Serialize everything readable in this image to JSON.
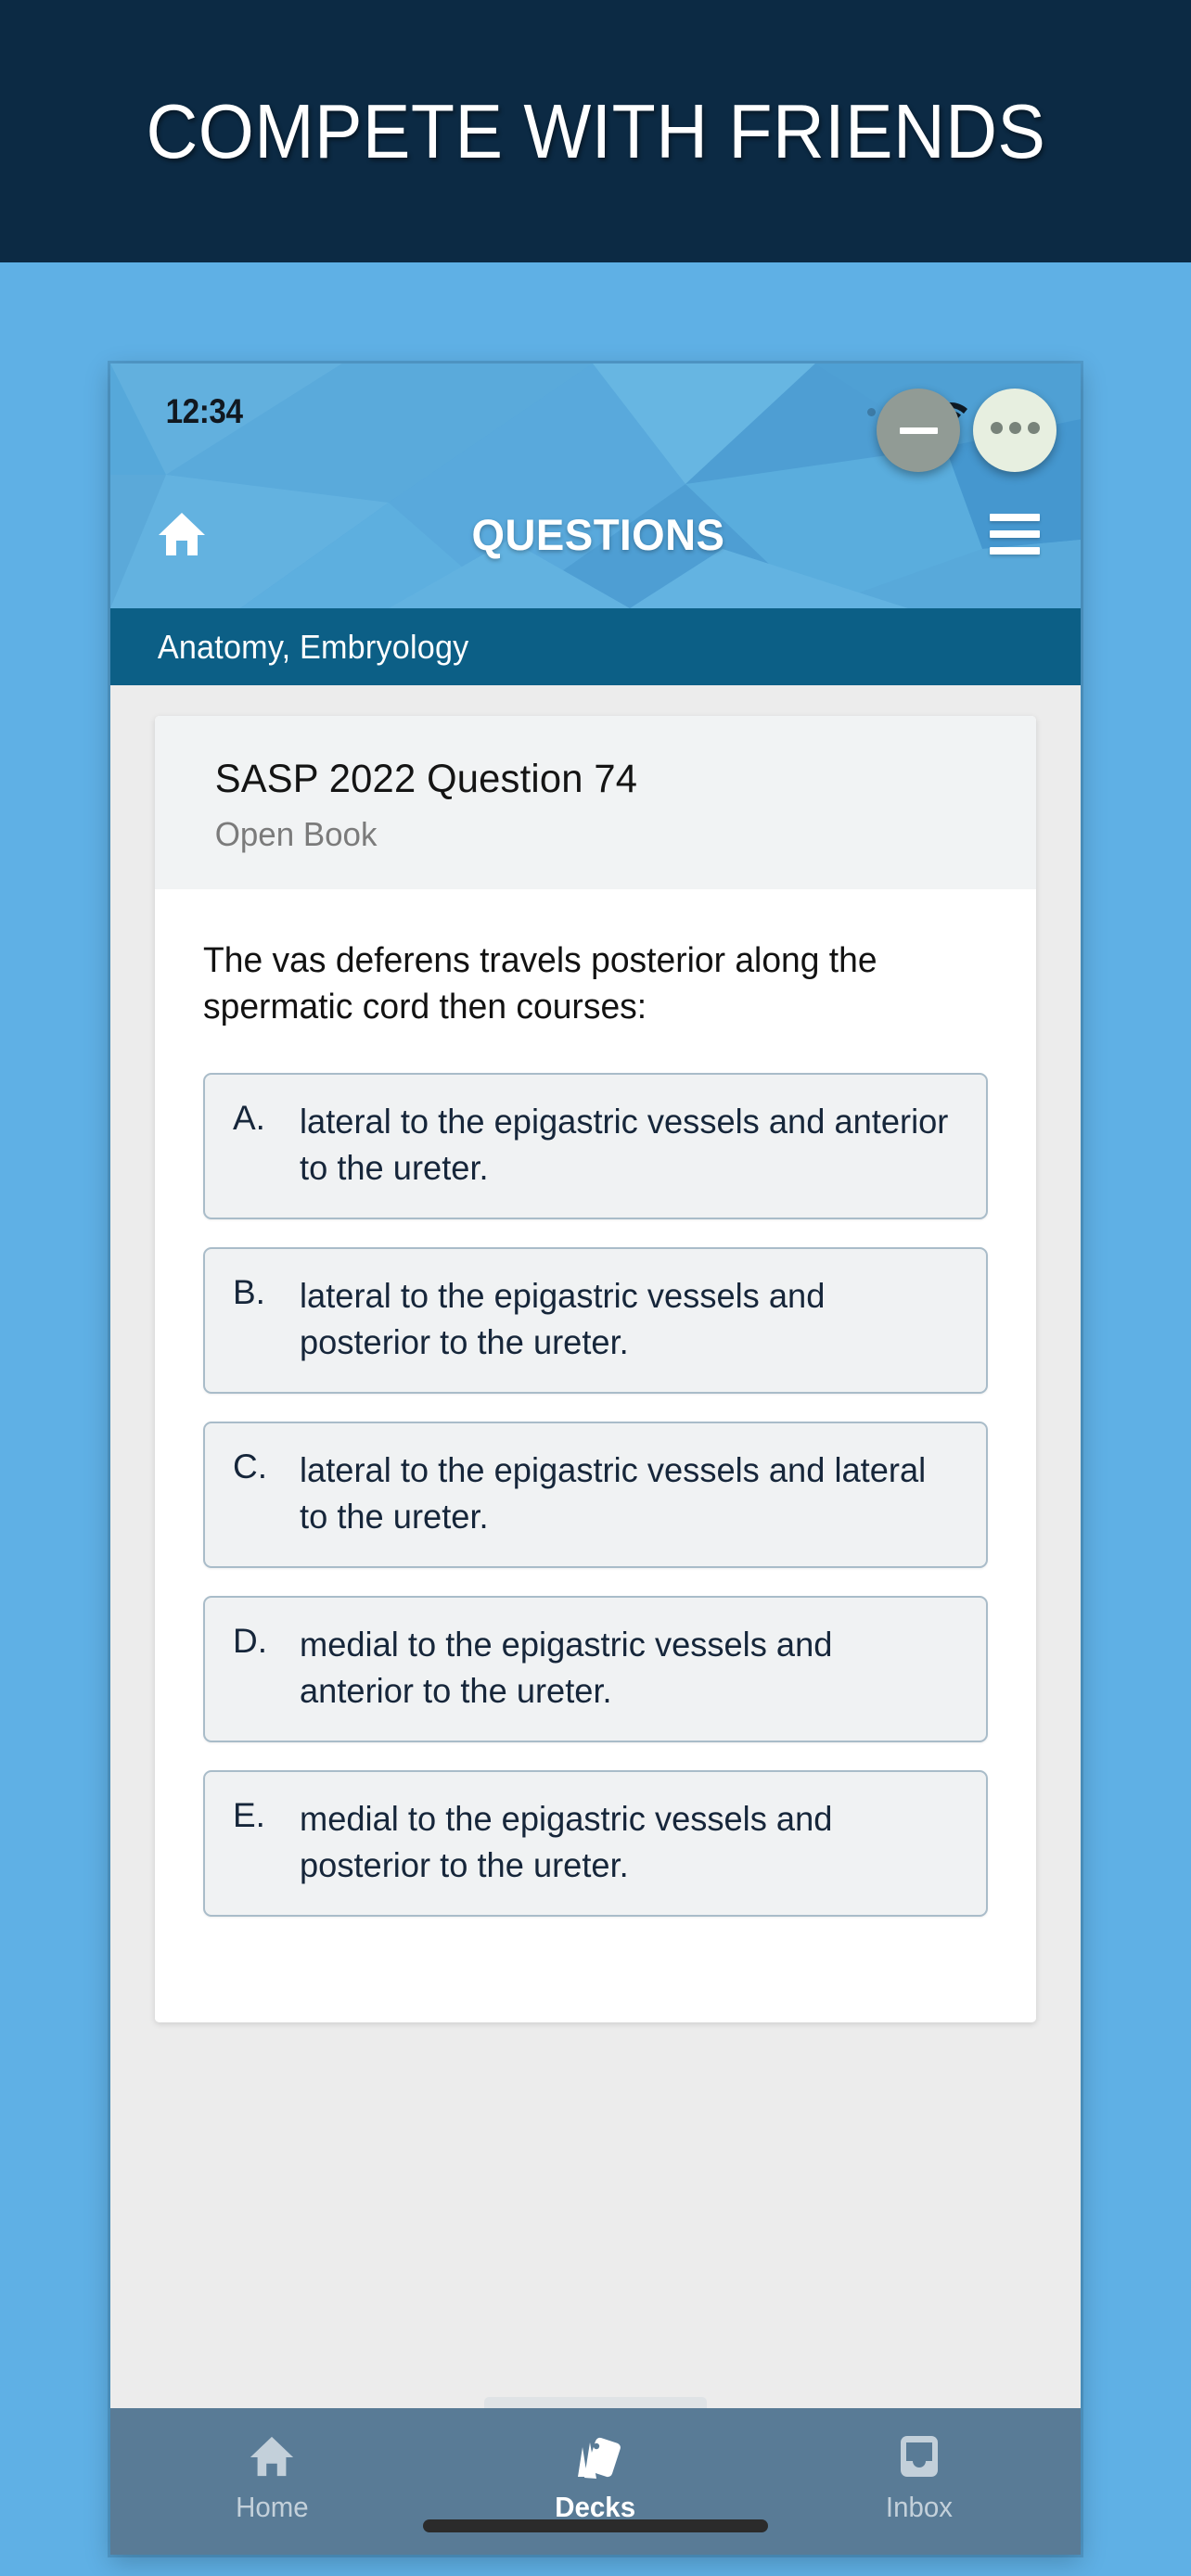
{
  "promo": {
    "headline": "COMPETE WITH FRIENDS",
    "banner_bg": "#0c2a44",
    "page_bg": "#5fb0e5"
  },
  "phone": {
    "status_bar": {
      "time": "12:34",
      "signal_icon": "signal-dots-icon",
      "wifi_icon": "wifi-icon",
      "battery_icon": "battery-full-icon"
    },
    "nav_bar": {
      "home_icon": "home-icon",
      "title": "QUESTIONS",
      "menu_icon": "hamburger-menu-icon",
      "bg": "#56a8da"
    },
    "category_bar": {
      "label": "Anatomy, Embryology",
      "bg": "#0c5f86",
      "minus_button": {
        "icon": "minus-icon",
        "color": "#919b95"
      },
      "more_button": {
        "icon": "ellipsis-icon",
        "color": "#e7efe0"
      }
    },
    "question_card": {
      "title": "SASP 2022 Question 74",
      "subtitle": "Open Book",
      "stem": "The vas deferens travels posterior along the spermatic cord then courses:",
      "options": [
        {
          "letter": "A.",
          "text": "lateral to the epigastric vessels and anterior to the ureter."
        },
        {
          "letter": "B.",
          "text": "lateral to the epigastric vessels and posterior to the ureter."
        },
        {
          "letter": "C.",
          "text": "lateral to the epigastric vessels and lateral to the ureter."
        },
        {
          "letter": "D.",
          "text": "medial to the epigastric vessels and anterior to the ureter."
        },
        {
          "letter": "E.",
          "text": "medial to the epigastric vessels and posterior to the ureter."
        }
      ]
    },
    "tab_bar": {
      "bg": "#597b96",
      "tabs": [
        {
          "label": "Home",
          "icon": "home-icon",
          "active": false
        },
        {
          "label": "Decks",
          "icon": "cards-deck-icon",
          "active": true
        },
        {
          "label": "Inbox",
          "icon": "inbox-tray-icon",
          "active": false
        }
      ]
    }
  }
}
